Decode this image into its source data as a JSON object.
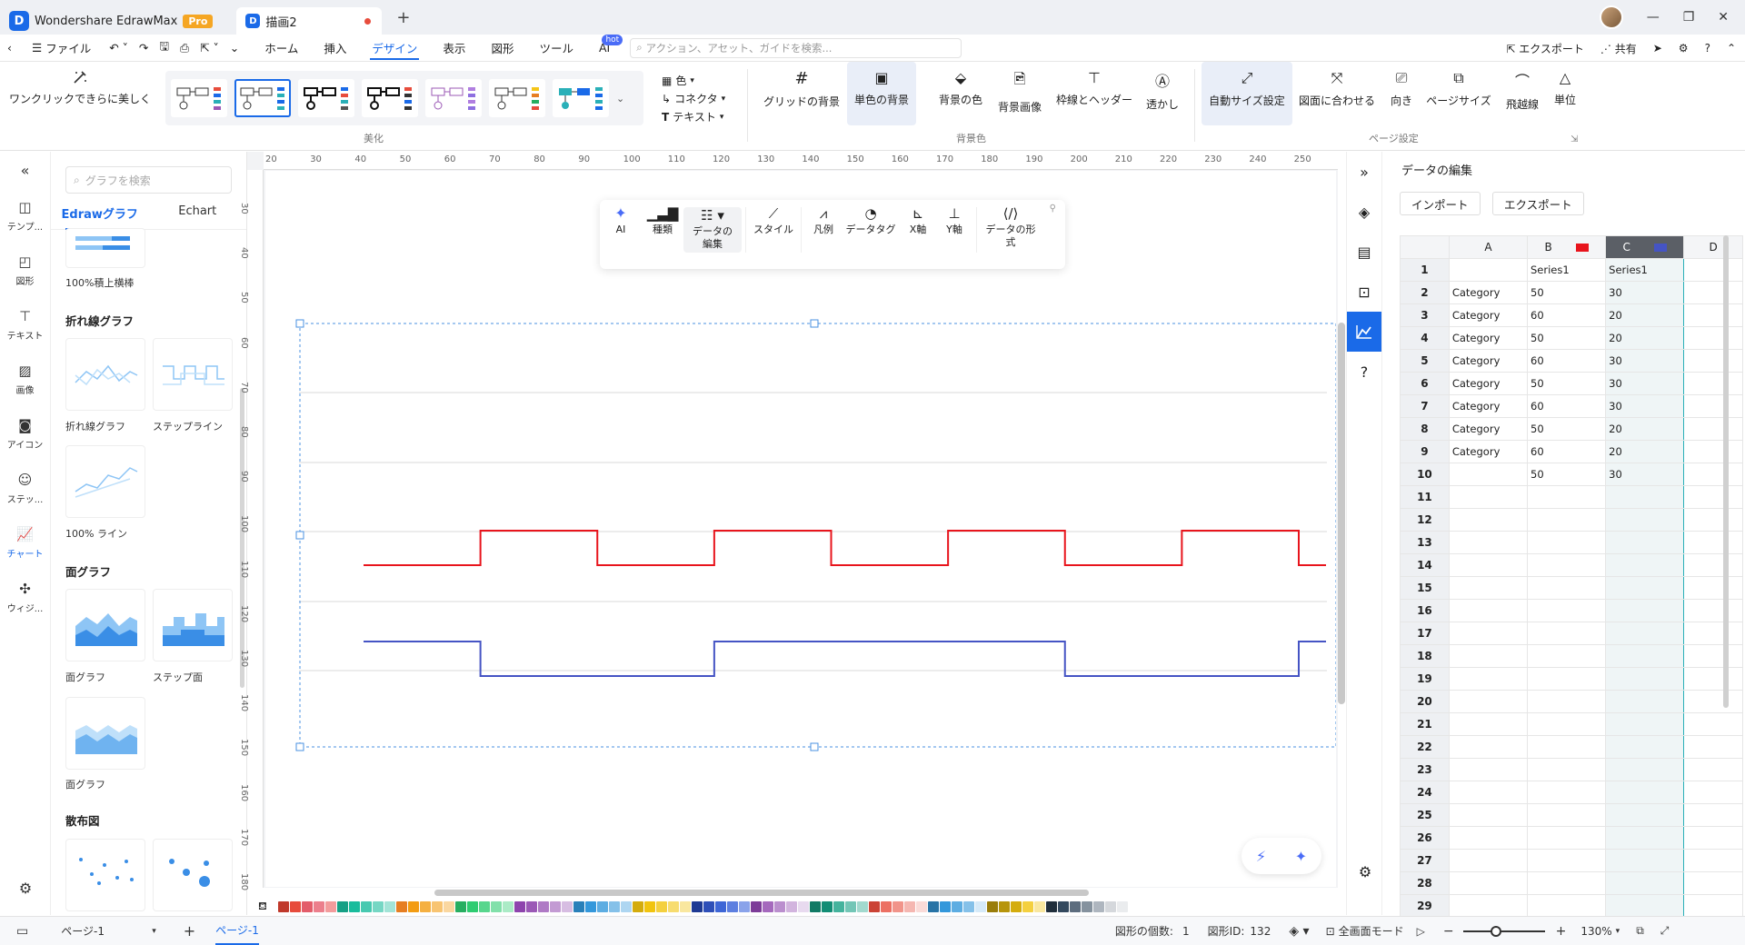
{
  "app": {
    "name": "Wondershare EdrawMax",
    "badge": "Pro",
    "doc_tab": "描画2"
  },
  "menu": {
    "file": "ファイル",
    "tabs": [
      "ホーム",
      "挿入",
      "デザイン",
      "表示",
      "図形",
      "ツール",
      "AI"
    ],
    "active_tab": "デザイン",
    "hot": "hot",
    "search_placeholder": "アクション、アセット、ガイドを検索...",
    "export": "エクスポート",
    "share": "共有"
  },
  "ribbon": {
    "beautify": "ワンクリックできらに美しく",
    "color": "色",
    "connector": "コネクタ",
    "text": "テキスト",
    "group_beautify": "美化",
    "grid_bg": "グリッドの背景",
    "solid_bg": "単色の背景",
    "bg_color": "背景の色",
    "bg_image": "背景画像",
    "border_header": "枠線とヘッダー",
    "watermark": "透かし",
    "group_bg": "背景色",
    "auto_size": "自動サイズ設定",
    "fit_drawing": "図面に合わせる",
    "orientation": "向き",
    "page_size": "ページサイズ",
    "jump_line": "飛越線",
    "unit": "単位",
    "group_page": "ページ設定"
  },
  "leftnav": [
    "テンプ...",
    "図形",
    "テキスト",
    "画像",
    "アイコン",
    "ステッ...",
    "チャート",
    "ウィジ..."
  ],
  "library": {
    "search_placeholder": "グラフを検索",
    "tab_edraw": "Edrawグラフ",
    "tab_echart": "Echart",
    "item_stacked": "100%積上横棒",
    "cat_line": "折れ線グラフ",
    "line": "折れ線グラフ",
    "step_line": "ステップライン",
    "line100": "100% ライン",
    "cat_area": "面グラフ",
    "area": "面グラフ",
    "step_area": "ステップ面",
    "area2": "面グラフ",
    "cat_scatter": "散布図"
  },
  "ruler": {
    "h": [
      "20",
      "30",
      "40",
      "50",
      "60",
      "70",
      "80",
      "90",
      "100",
      "110",
      "120",
      "130",
      "140",
      "150",
      "160",
      "170",
      "180",
      "190",
      "200",
      "210",
      "220",
      "230",
      "240",
      "250"
    ],
    "v": [
      "30",
      "40",
      "50",
      "60",
      "70",
      "80",
      "90",
      "100",
      "110",
      "120",
      "130",
      "140",
      "150",
      "160",
      "170",
      "180"
    ]
  },
  "floatbar": {
    "ai": "AI",
    "type": "種類",
    "edit_data": "データの編集",
    "style": "スタイル",
    "legend": "凡例",
    "data_tag": "データタグ",
    "x_axis": "X軸",
    "y_axis": "Y軸",
    "format": "データの形式"
  },
  "chart_data": {
    "type": "line",
    "step": true,
    "categories": [
      "Category",
      "Category",
      "Category",
      "Category",
      "Category",
      "Category",
      "Category",
      "Category",
      ""
    ],
    "series": [
      {
        "name": "Series1",
        "color": "#e8141c",
        "values": [
          50,
          60,
          50,
          60,
          50,
          60,
          50,
          60,
          50
        ]
      },
      {
        "name": "Series1",
        "color": "#4554c4",
        "values": [
          30,
          20,
          20,
          30,
          30,
          30,
          20,
          20,
          30
        ]
      }
    ],
    "ylim": [
      0,
      100
    ],
    "grid": true
  },
  "datapanel": {
    "title": "データの編集",
    "import": "インポート",
    "export": "エクスポート",
    "cols": [
      "A",
      "B",
      "C",
      "D"
    ],
    "rows": 29
  },
  "status": {
    "page_sel": "ページ-1",
    "page_tab": "ページ-1",
    "shape_count_label": "図形の個数:",
    "shape_count": "1",
    "shape_id_label": "図形ID:",
    "shape_id": "132",
    "fullscreen": "全画面モード",
    "zoom": "130%"
  }
}
